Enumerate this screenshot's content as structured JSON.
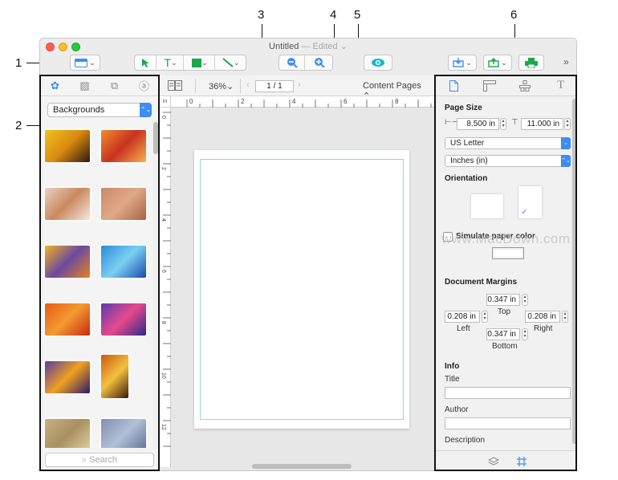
{
  "callouts": [
    "1",
    "2",
    "3",
    "4",
    "5",
    "6"
  ],
  "window": {
    "title": "Untitled",
    "edited": "— Edited ⌄"
  },
  "toolbar": {
    "zoom_out_icon": "zoom-out-icon",
    "zoom_in_icon": "zoom-in-icon",
    "more": "»"
  },
  "left_panel": {
    "category": "Backgrounds",
    "search_placeholder": "Search",
    "thumbnails": [
      {
        "colors": [
          "#f0c020",
          "#d98a10",
          "#2a1a10"
        ]
      },
      {
        "colors": [
          "#f28a30",
          "#c8321e",
          "#f5b050"
        ]
      },
      {
        "colors": [
          "#e8d2c0",
          "#c98860",
          "#f4e8dc"
        ]
      },
      {
        "colors": [
          "#c88a6a",
          "#e0a888",
          "#a86244"
        ]
      },
      {
        "colors": [
          "#f4b020",
          "#6a4aa0",
          "#e88020"
        ]
      },
      {
        "colors": [
          "#2a8ad8",
          "#7ad0f0",
          "#1a4ab0"
        ]
      },
      {
        "colors": [
          "#e85a1a",
          "#f49a30",
          "#c82a10"
        ]
      },
      {
        "colors": [
          "#5a3ab0",
          "#e84a8a",
          "#2a2a8a"
        ]
      },
      {
        "colors": [
          "#5a3aa0",
          "#f0a020",
          "#2a1a6a"
        ]
      },
      {
        "colors": [
          "#c85a10",
          "#f4c040",
          "#3a1a08"
        ]
      },
      {
        "colors": [
          "#c8b080",
          "#a89060",
          "#e0d0a0"
        ]
      },
      {
        "colors": [
          "#8090b0",
          "#b0c0d8",
          "#607090"
        ]
      }
    ]
  },
  "canvas": {
    "zoom": "36%⌄",
    "page": "1 / 1",
    "content_pages": "Content Pages ⌃⌄",
    "ruler_unit": "in",
    "hruler_labels": [
      "0",
      "2",
      "4",
      "6",
      "8"
    ],
    "vruler_labels": [
      "0",
      "2",
      "4",
      "6",
      "8",
      "10",
      "12"
    ]
  },
  "inspector": {
    "page_size_title": "Page Size",
    "width": "8.500 in",
    "height": "11.000 in",
    "paper": "US Letter",
    "units": "Inches (in)",
    "orientation_title": "Orientation",
    "simulate_label": "Simulate paper color",
    "margins_title": "Document Margins",
    "margin_top": "0.347 in",
    "margin_top_label": "Top",
    "margin_left": "0.208 in",
    "margin_left_label": "Left",
    "margin_right": "0.208 in",
    "margin_right_label": "Right",
    "margin_bottom": "0.347 in",
    "margin_bottom_label": "Bottom",
    "info_title": "Info",
    "title_label": "Title",
    "author_label": "Author",
    "description_label": "Description"
  },
  "watermark": "www.MacDown.com"
}
